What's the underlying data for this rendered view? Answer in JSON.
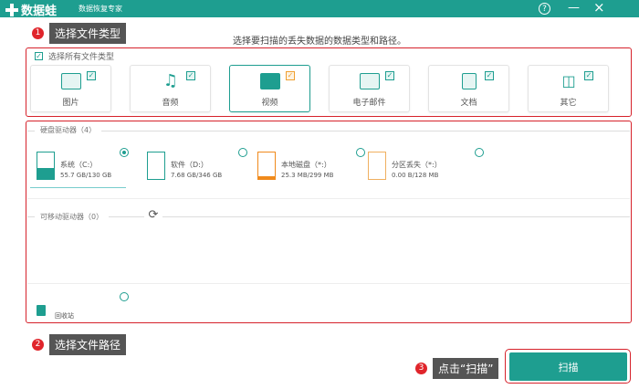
{
  "app": {
    "name": "数据蛙",
    "subtitle": "数据恢复专家",
    "help": "?",
    "minimize": "—",
    "close": "×"
  },
  "heading": "选择要扫描的丢失数据的数据类型和路径。",
  "callouts": [
    {
      "num": "1",
      "text": "选择文件类型"
    },
    {
      "num": "2",
      "text": "选择文件路径"
    },
    {
      "num": "3",
      "text": "点击“扫描”"
    }
  ],
  "file_types": {
    "select_all": "选择所有文件类型",
    "items": [
      {
        "label": "图片",
        "checked": true
      },
      {
        "label": "音频",
        "checked": true
      },
      {
        "label": "视频",
        "checked": true
      },
      {
        "label": "电子邮件",
        "checked": true
      },
      {
        "label": "文档",
        "checked": true
      },
      {
        "label": "其它",
        "checked": true
      }
    ]
  },
  "hard_drives": {
    "title": "硬盘驱动器（4）",
    "items": [
      {
        "name": "系统（C:）",
        "size": "55.7 GB/130 GB",
        "selected": true,
        "color": "#1e9e90",
        "fill": 0.43
      },
      {
        "name": "软件（D:）",
        "size": "7.68 GB/346 GB",
        "selected": false,
        "color": "#1e9e90",
        "fill": 0.02
      },
      {
        "name": "本地磁盘（*:）",
        "size": "25.3 MB/299 MB",
        "selected": false,
        "color": "#f08a1c",
        "fill": 0.08
      },
      {
        "name": "分区丢失（*:）",
        "size": "0.00  B/128 MB",
        "selected": false,
        "color": "#f0b060",
        "fill": 0
      }
    ]
  },
  "removable": {
    "title": "可移动驱动器（0）"
  },
  "recycle_bin": {
    "label": "回收站"
  },
  "scan_button": "扫描",
  "check": "✓"
}
